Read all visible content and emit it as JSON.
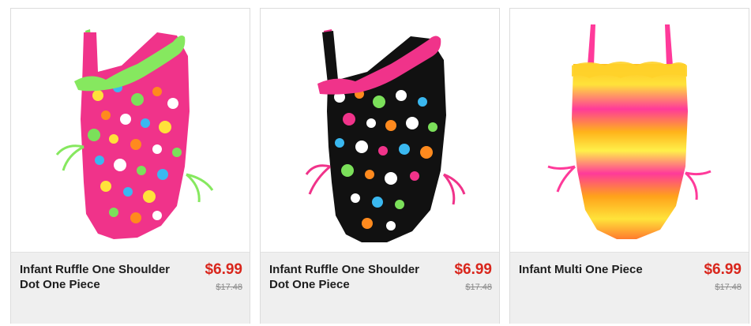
{
  "products": [
    {
      "name": "Infant Ruffle One Shoulder Dot One Piece",
      "price": "$6.99",
      "original_price": "$17.48",
      "image_icon": "pink-polka-dot-swimsuit-image"
    },
    {
      "name": "Infant Ruffle One Shoulder Dot One Piece",
      "price": "$6.99",
      "original_price": "$17.48",
      "image_icon": "black-polka-dot-swimsuit-image"
    },
    {
      "name": "Infant Multi One Piece",
      "price": "$6.99",
      "original_price": "$17.48",
      "image_icon": "tie-dye-swimsuit-image"
    }
  ],
  "colors": {
    "sale_price": "#d9261c",
    "info_background": "#efefef",
    "card_border": "#dcdcdc"
  }
}
